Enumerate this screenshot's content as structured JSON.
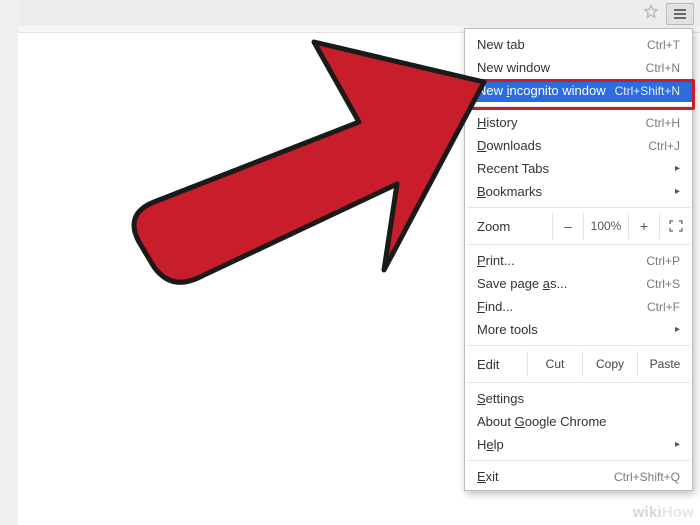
{
  "chrome": {
    "star_icon": "star-icon",
    "menu_button": "hamburger-icon"
  },
  "menu": {
    "group1": [
      {
        "label_pre": "",
        "mn": "",
        "label": "New tab",
        "shortcut": "Ctrl+T"
      },
      {
        "label_pre": "",
        "mn": "",
        "label": "New window",
        "shortcut": "Ctrl+N"
      },
      {
        "label_pre": "New ",
        "mn": "i",
        "label": "ncognito window",
        "shortcut": "Ctrl+Shift+N",
        "highlight": true
      }
    ],
    "group2": [
      {
        "label_pre": "",
        "mn": "H",
        "label": "istory",
        "shortcut": "Ctrl+H"
      },
      {
        "label_pre": "",
        "mn": "D",
        "label": "ownloads",
        "shortcut": "Ctrl+J"
      },
      {
        "label_pre": "",
        "mn": "",
        "label": "Recent Tabs",
        "submenu": true
      },
      {
        "label_pre": "",
        "mn": "B",
        "label": "ookmarks",
        "submenu": true
      }
    ],
    "zoom": {
      "label": "Zoom",
      "minus": "–",
      "value": "100%",
      "plus": "+",
      "fullscreen": "fullscreen-icon"
    },
    "group3": [
      {
        "label_pre": "",
        "mn": "P",
        "label": "rint...",
        "shortcut": "Ctrl+P"
      },
      {
        "label_pre": "Save page ",
        "mn": "a",
        "label": "s...",
        "shortcut": "Ctrl+S"
      },
      {
        "label_pre": "",
        "mn": "F",
        "label": "ind...",
        "shortcut": "Ctrl+F"
      },
      {
        "label_pre": "",
        "mn": "",
        "label": "More tools",
        "submenu": true
      }
    ],
    "edit": {
      "label": "Edit",
      "cut": "Cut",
      "copy": "Copy",
      "paste": "Paste"
    },
    "group4": [
      {
        "label_pre": "",
        "mn": "S",
        "label": "ettings"
      },
      {
        "label_pre": "About ",
        "mn": "G",
        "label": "oogle Chrome"
      },
      {
        "label_pre": "H",
        "mn": "e",
        "label": "lp",
        "submenu": true
      }
    ],
    "group5": [
      {
        "label_pre": "",
        "mn": "E",
        "label": "xit",
        "shortcut": "Ctrl+Shift+Q"
      }
    ]
  },
  "watermark": "wikiHow"
}
